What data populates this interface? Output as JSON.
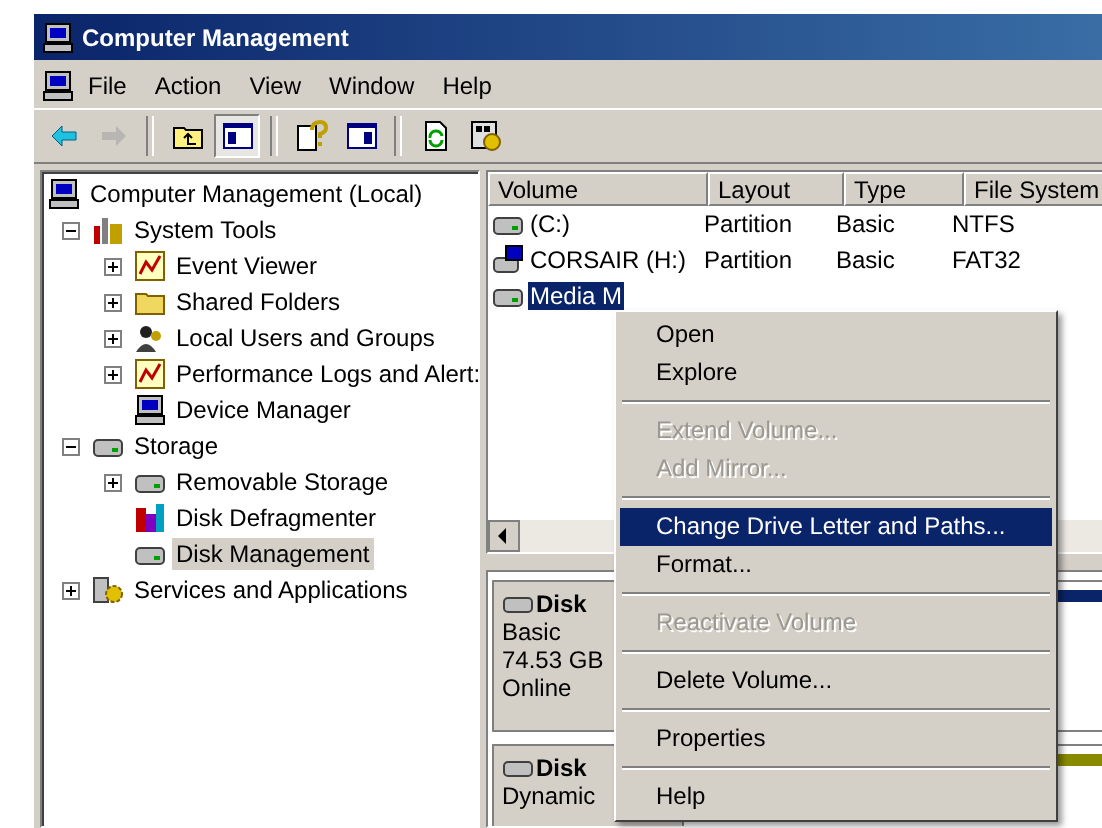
{
  "window": {
    "title": "Computer Management"
  },
  "menu_bar": [
    "File",
    "Action",
    "View",
    "Window",
    "Help"
  ],
  "toolbar": [
    {
      "pressed": false,
      "disabled": false
    },
    {
      "pressed": false,
      "disabled": true
    },
    {
      "pressed": false,
      "disabled": false
    },
    {
      "pressed": true,
      "disabled": false
    },
    {
      "pressed": false,
      "disabled": false
    },
    {
      "pressed": false,
      "disabled": false
    },
    {
      "pressed": false,
      "disabled": false
    },
    {
      "pressed": false,
      "disabled": false
    }
  ],
  "tree": {
    "label": "Computer Management (Local)",
    "selected": false,
    "children": [
      {
        "label": "System Tools",
        "selected": false,
        "expanded": true,
        "children": [
          {
            "label": "Event Viewer",
            "selected": false,
            "expanded": false
          },
          {
            "label": "Shared Folders",
            "selected": false,
            "expanded": false
          },
          {
            "label": "Local Users and Groups",
            "selected": false,
            "expanded": false
          },
          {
            "label": "Performance Logs and Alert:",
            "selected": false,
            "expanded": false
          },
          {
            "label": "Device Manager",
            "selected": false
          }
        ]
      },
      {
        "label": "Storage",
        "selected": false,
        "expanded": true,
        "children": [
          {
            "label": "Removable Storage",
            "selected": false,
            "expanded": false
          },
          {
            "label": "Disk Defragmenter",
            "selected": false
          },
          {
            "label": "Disk Management",
            "selected": true
          }
        ]
      },
      {
        "label": "Services and Applications",
        "selected": false,
        "expanded": false
      }
    ]
  },
  "volumes": {
    "columns": [
      "Volume",
      "Layout",
      "Type",
      "File System"
    ],
    "rows": [
      {
        "cells": [
          "(C:)",
          "Partition",
          "Basic",
          "NTFS"
        ],
        "selected": false
      },
      {
        "cells": [
          "CORSAIR (H:)",
          "Partition",
          "Basic",
          "FAT32"
        ],
        "selected": false
      },
      {
        "cells": [
          "Media M"
        ],
        "selected": true
      }
    ]
  },
  "disks": [
    {
      "name": "Disk",
      "lines": [
        "Basic",
        "74.53 GB",
        "Online"
      ],
      "color": "#0a246a"
    },
    {
      "name": "Disk",
      "lines": [
        "Dynamic"
      ],
      "color": "#8a8a00"
    }
  ],
  "context_menu": [
    {
      "kind": "item",
      "label": "Open",
      "disabled": false,
      "selected": false
    },
    {
      "kind": "item",
      "label": "Explore",
      "disabled": false,
      "selected": false
    },
    {
      "kind": "separator"
    },
    {
      "kind": "item",
      "label": "Extend Volume...",
      "disabled": true,
      "selected": false
    },
    {
      "kind": "item",
      "label": "Add Mirror...",
      "disabled": true,
      "selected": false
    },
    {
      "kind": "separator"
    },
    {
      "kind": "item",
      "label": "Change Drive Letter and Paths...",
      "disabled": false,
      "selected": true
    },
    {
      "kind": "item",
      "label": "Format...",
      "disabled": false,
      "selected": false
    },
    {
      "kind": "separator"
    },
    {
      "kind": "item",
      "label": "Reactivate Volume",
      "disabled": true,
      "selected": false
    },
    {
      "kind": "separator"
    },
    {
      "kind": "item",
      "label": "Delete Volume...",
      "disabled": false,
      "selected": false
    },
    {
      "kind": "separator"
    },
    {
      "kind": "item",
      "label": "Properties",
      "disabled": false,
      "selected": false
    },
    {
      "kind": "separator"
    },
    {
      "kind": "item",
      "label": "Help",
      "disabled": false,
      "selected": false
    }
  ]
}
